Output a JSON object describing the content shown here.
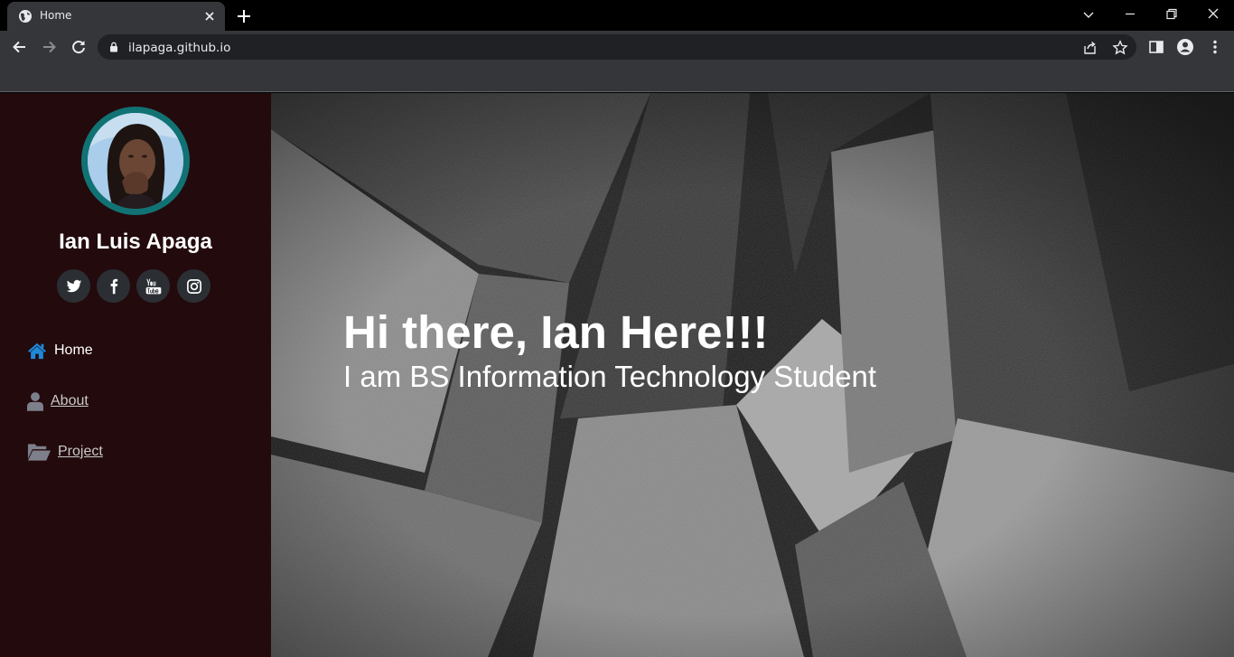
{
  "browser": {
    "tab_title": "Home",
    "url": "ilapaga.github.io"
  },
  "sidebar": {
    "profile_name": "Ian Luis Apaga",
    "social": [
      "twitter-icon",
      "facebook-icon",
      "youtube-icon",
      "instagram-icon"
    ],
    "nav": [
      {
        "label": "Home",
        "icon": "home-icon",
        "color": "#ffffff"
      },
      {
        "label": "About",
        "icon": "user-icon",
        "color": "#c9c9c9"
      },
      {
        "label": "Project",
        "icon": "folder-open-icon",
        "color": "#c9c9c9"
      }
    ],
    "accent_border": "#117274",
    "home_icon_color": "#1e88d8",
    "background": "#230a0d"
  },
  "hero": {
    "title": "Hi there, Ian Here!!!",
    "subtitle": "I am BS Information Technology Student"
  }
}
